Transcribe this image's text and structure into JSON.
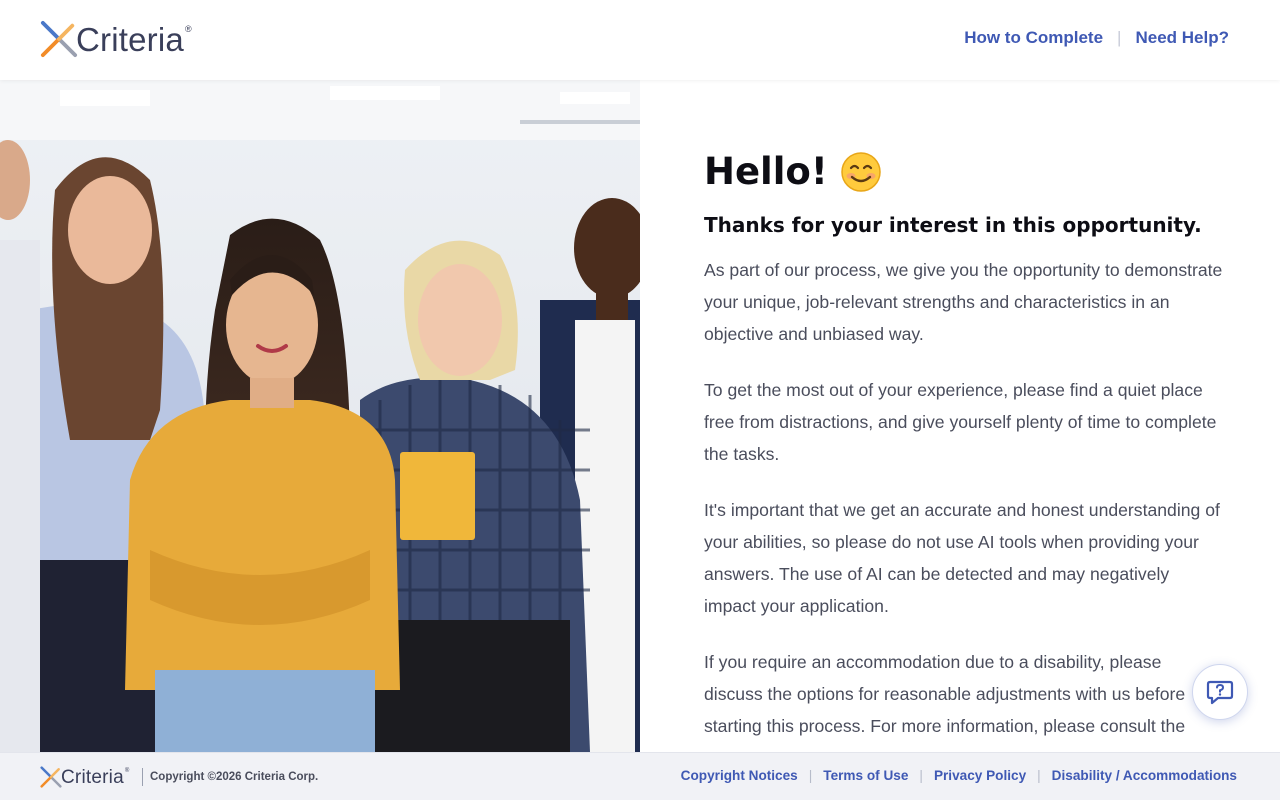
{
  "brand": {
    "name": "Criteria",
    "registered_mark": "®",
    "colors": {
      "accent": "#3f59b4",
      "logo_orange": "#f28c28",
      "logo_blue": "#4a78c8",
      "logo_gray": "#9aa0b0",
      "text_dark": "#0d0d14",
      "body_text": "#4a4d5c"
    }
  },
  "header": {
    "nav": [
      {
        "label": "How to Complete"
      },
      {
        "label": "Need Help?"
      }
    ]
  },
  "hero": {
    "image_alt": "photo"
  },
  "main": {
    "greeting": "Hello!",
    "greeting_emoji": "smiling-face-emoji",
    "subheading": "Thanks for your interest in this opportunity.",
    "paragraphs": [
      "As part of our process, we give you the opportunity to demonstrate your unique, job-relevant strengths and characteristics in an objective and unbiased way.",
      "To get the most out of your experience, please find a quiet place free from distractions, and give yourself plenty of time to complete the tasks.",
      "It's important that we get an accurate and honest understanding of your abilities, so please do not use AI tools when providing your answers. The use of AI can be detected and may negatively impact your application.",
      "If you require an accommodation due to a disability, please discuss the options for reasonable adjustments with us before starting this process. For more information, please consult the"
    ]
  },
  "chat_button": {
    "icon": "chat-help-icon"
  },
  "footer": {
    "copyright": "Copyright ©2026 Criteria Corp.",
    "links": [
      {
        "label": "Copyright Notices"
      },
      {
        "label": "Terms of Use"
      },
      {
        "label": "Privacy Policy"
      },
      {
        "label": "Disability / Accommodations"
      }
    ]
  }
}
